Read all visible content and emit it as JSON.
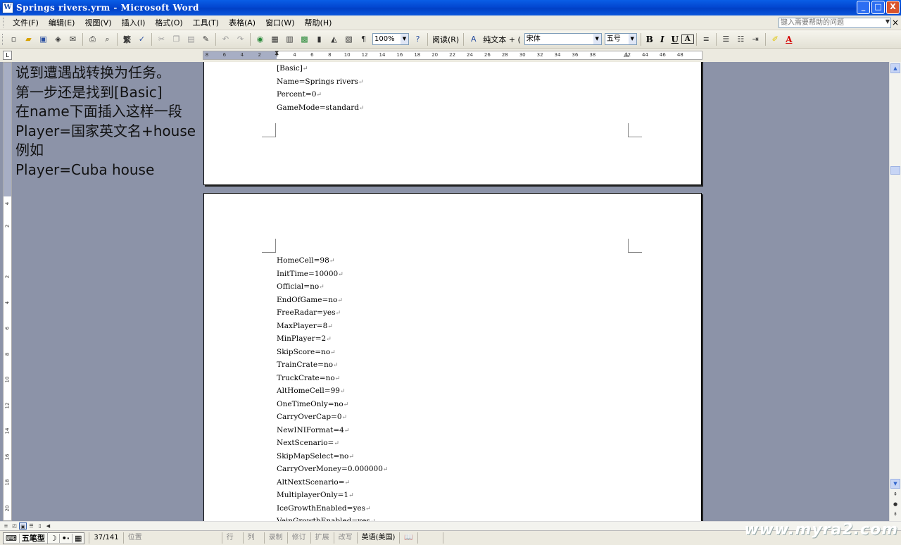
{
  "window": {
    "title": "Springs rivers.yrm - Microsoft Word",
    "app_icon": "W",
    "buttons": {
      "minimize": "_",
      "maximize": "□",
      "close": "X"
    }
  },
  "menu": {
    "items": [
      "文件(F)",
      "编辑(E)",
      "视图(V)",
      "插入(I)",
      "格式(O)",
      "工具(T)",
      "表格(A)",
      "窗口(W)",
      "帮助(H)"
    ],
    "help_placeholder": "键入需要帮助的问题",
    "close": "×"
  },
  "toolbar": {
    "zoom": "100%",
    "read_label": "阅读(R)",
    "style": "纯文本 + (",
    "font": "宋体",
    "size": "五号",
    "bold": "B",
    "italic": "I",
    "underline": "U",
    "charborder": "A",
    "fontcolor": "A"
  },
  "ruler": {
    "numbers": [
      "8",
      "6",
      "4",
      "2",
      "2",
      "4",
      "6",
      "8",
      "10",
      "12",
      "14",
      "16",
      "18",
      "20",
      "22",
      "24",
      "26",
      "28",
      "30",
      "32",
      "34",
      "36",
      "38",
      "42",
      "44",
      "46",
      "48"
    ],
    "vertical": [
      "4",
      "2",
      "2",
      "4",
      "6",
      "8",
      "10",
      "12",
      "14",
      "16",
      "18",
      "20"
    ]
  },
  "overlay": {
    "lines": [
      "说到遭遇战转换为任务。",
      "第一步还是找到[Basic]",
      "在name下面插入这样一段",
      "Player=国家英文名+house",
      "例如",
      "Player=Cuba house"
    ]
  },
  "page1": {
    "lines": [
      "[Basic]",
      "Name=Springs rivers",
      "Percent=0",
      "GameMode=standard"
    ]
  },
  "page2": {
    "lines": [
      "HomeCell=98",
      "InitTime=10000",
      "Official=no",
      "EndOfGame=no",
      "FreeRadar=yes",
      "MaxPlayer=8",
      "MinPlayer=2",
      "SkipScore=no",
      "TrainCrate=no",
      "TruckCrate=no",
      "AltHomeCell=99",
      "OneTimeOnly=no",
      "CarryOverCap=0",
      "NewINIFormat=4",
      "NextScenario=",
      "SkipMapSelect=no",
      "CarryOverMoney=0.000000",
      "AltNextScenario=",
      "MultiplayerOnly=1",
      "IceGrowthEnabled=yes",
      "VeinGrowthEnabled=yes"
    ]
  },
  "status": {
    "ime_name": "五笔型",
    "page": "37/141",
    "position": "位置",
    "line": "行",
    "col": "列",
    "rec": "录制",
    "trk": "修订",
    "ext": "扩展",
    "ovr": "改写",
    "language": "英语(美国)"
  },
  "watermark": "www.myra2.com"
}
